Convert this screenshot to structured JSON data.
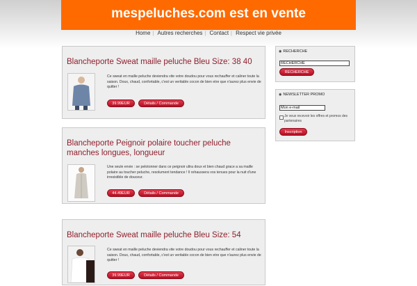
{
  "site_title": "mespeluches.com est en vente",
  "nav": [
    "Home",
    "Autres recherches",
    "Contact",
    "Respect vie privée"
  ],
  "products": [
    {
      "title": "Blancheporte Sweat maille peluche Bleu Size: 38 40",
      "description": "Ce sweat en maille peluche deviendra vite votre doudou pour vous rechauffer et caliner toute la saison. Doux, chaud, confortable, c'est un veritable cocon de bien etre que n'aurez plus envie de quitter !",
      "price": "39.99EUR",
      "details": "Détails / Commande"
    },
    {
      "title": "Blancheporte Peignoir polaire toucher peluche manches longues, longueur",
      "description": "Une seule envie : se pelotonner dans ce peignoir ultra doux et bien chaud grace a sa maille polaire au toucher peluche, resolument tendance ! Il rehaussera vos tenues pour la nuit d'une irresistible de douceur.",
      "price": "44.49EUR",
      "details": "Détails / Commande"
    },
    {
      "title": "Blancheporte Sweat maille peluche Bleu Size: 54",
      "description": "Ce sweat en maille peluche deviendra vite votre doudou pour vous rechauffer et caliner toute la saison. Doux, chaud, confortable, c'est un veritable cocon de bien etre que n'aurez plus envie de quitter !",
      "price": "39.99EUR",
      "details": "Détails / Commande"
    }
  ],
  "search_box": {
    "title": "RECHERCHE",
    "value": "RECHERCHE",
    "button": "RECHERCHE"
  },
  "newsletter": {
    "title": "NEWSLETTER PROMO",
    "placeholder": "Mon e-mail",
    "optin": "Je veux recevoir les offres et promos des partenaires",
    "button": "Inscription"
  }
}
